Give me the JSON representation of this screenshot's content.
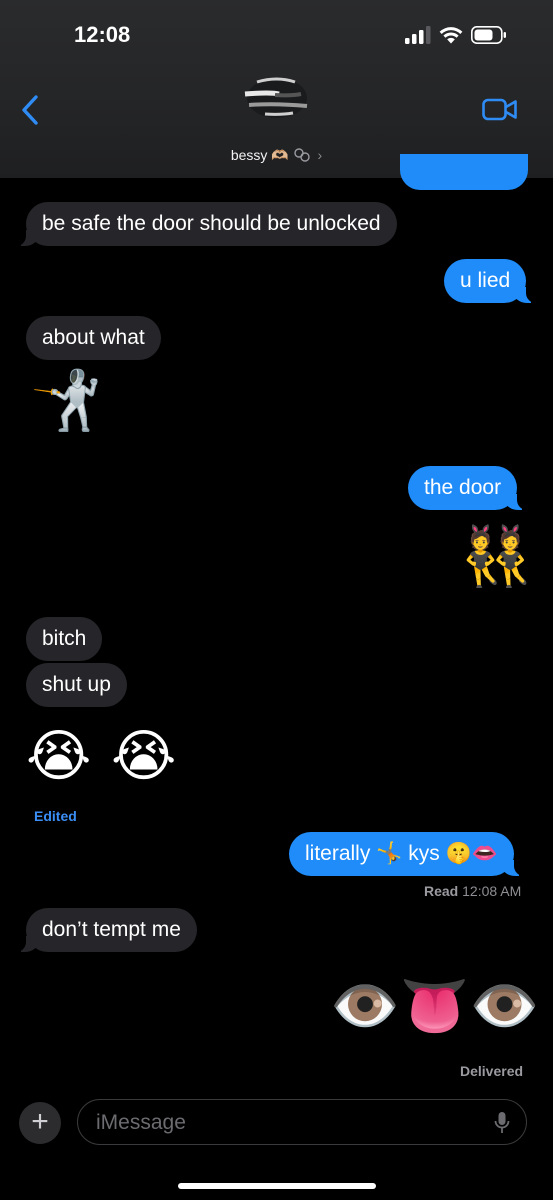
{
  "status": {
    "time": "12:08"
  },
  "header": {
    "contact_name": "bessy",
    "contact_emoji": "🫶🏼",
    "chevron": "›"
  },
  "messages": {
    "m1": "be safe the door should be unlocked",
    "m2": "u lied",
    "m3": "about what",
    "m4": "🤺",
    "m5": "the door",
    "m6": "👯",
    "m7": "bitch",
    "m8": "shut up",
    "m9": "😭 😭",
    "m10_pre": "literally",
    "m10_emoji1": "🤸",
    "m10_mid": "kys",
    "m10_emoji2": "🤫👄",
    "m11": "don’t tempt me",
    "m12": "👁️👅👁️"
  },
  "meta": {
    "edited": "Edited",
    "read_label": "Read",
    "read_time": "12:08 AM",
    "delivered": "Delivered"
  },
  "compose": {
    "placeholder": "iMessage",
    "plus": "+"
  },
  "colors": {
    "outgoing": "#1f8cf9",
    "incoming": "#26252a",
    "accent": "#3b8ef5"
  },
  "icons": [
    "back-chevron-icon",
    "video-call-icon",
    "signal-icon",
    "wifi-icon",
    "battery-icon",
    "microphone-icon",
    "plus-icon"
  ]
}
